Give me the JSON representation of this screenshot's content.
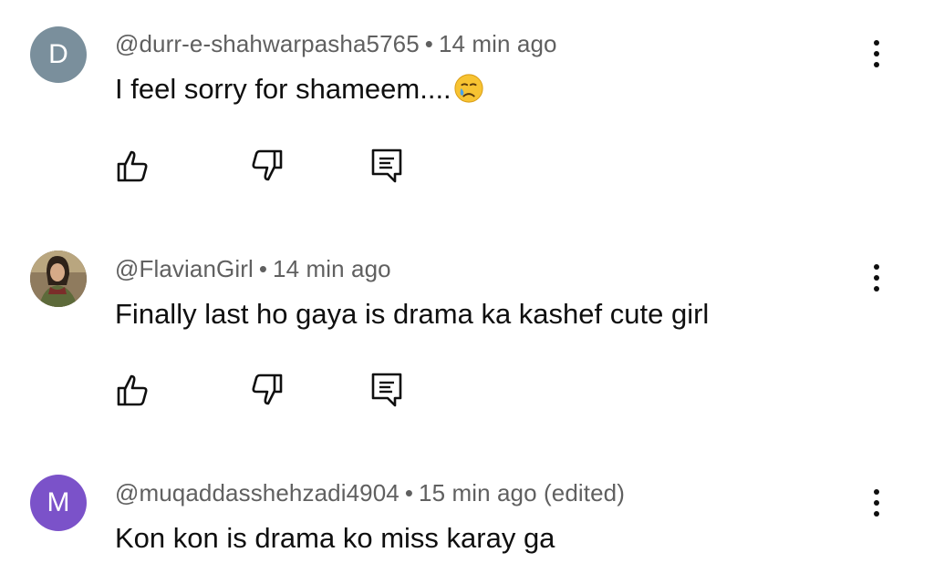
{
  "comments": [
    {
      "avatar_letter": "D",
      "avatar_color": "#7a8f9c",
      "handle": "@durr-e-shahwarpasha5765",
      "time": "14 min ago",
      "edited": "",
      "text": "I feel sorry for shameem....",
      "emoji": "crying-face"
    },
    {
      "avatar_letter": "",
      "avatar_color": "#6b5a45",
      "handle": "@FlavianGirl",
      "time": "14 min ago",
      "edited": "",
      "text": "Finally last ho gaya is drama ka kashef cute girl"
    },
    {
      "avatar_letter": "M",
      "avatar_color": "#7b52c9",
      "handle": "@muqaddasshehzadi4904",
      "time": "15 min ago",
      "edited": "(edited)",
      "text": "Kon kon is drama ko miss karay ga"
    }
  ],
  "separator": "•"
}
